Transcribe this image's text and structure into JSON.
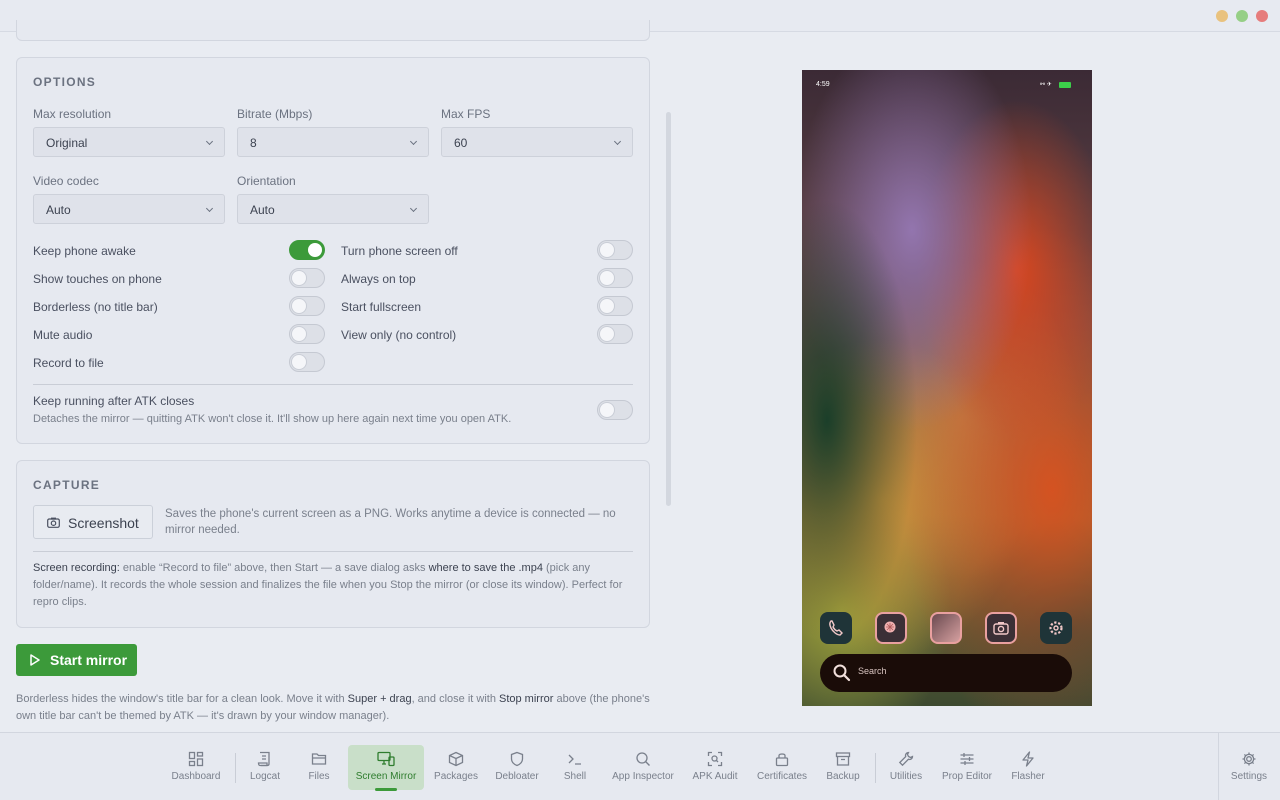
{
  "options": {
    "title": "OPTIONS",
    "max_resolution": {
      "label": "Max resolution",
      "value": "Original"
    },
    "bitrate": {
      "label": "Bitrate (Mbps)",
      "value": "8"
    },
    "max_fps": {
      "label": "Max FPS",
      "value": "60"
    },
    "video_codec": {
      "label": "Video codec",
      "value": "Auto"
    },
    "orientation": {
      "label": "Orientation",
      "value": "Auto"
    },
    "toggles_left": [
      {
        "label": "Keep phone awake",
        "on": true
      },
      {
        "label": "Show touches on phone",
        "on": false
      },
      {
        "label": "Borderless (no title bar)",
        "on": false
      },
      {
        "label": "Mute audio",
        "on": false
      },
      {
        "label": "Record to file",
        "on": false
      }
    ],
    "toggles_right": [
      {
        "label": "Turn phone screen off",
        "on": false
      },
      {
        "label": "Always on top",
        "on": false
      },
      {
        "label": "Start fullscreen",
        "on": false
      },
      {
        "label": "View only (no control)",
        "on": false
      }
    ],
    "keep_running": {
      "title": "Keep running after ATK closes",
      "desc": "Detaches the mirror — quitting ATK won't close it. It'll show up here again next time you open ATK.",
      "on": false
    }
  },
  "capture": {
    "title": "CAPTURE",
    "screenshot_label": "Screenshot",
    "screenshot_desc": "Saves the phone's current screen as a PNG. Works anytime a device is connected — no mirror needed.",
    "rec_lead": "Screen recording:",
    "rec_mid1": " enable “Record to file” above, then Start — a save dialog asks ",
    "rec_emph": "where to save the .mp4",
    "rec_tail": " (pick any folder/name). It records the whole session and finalizes the file when you Stop the mirror (or close its window). Perfect for repro clips."
  },
  "start_label": "Start mirror",
  "footnote": {
    "p1": "Borderless hides the window's title bar for a clean look. Move it with ",
    "k1": "Super + drag",
    "p2": ", and close it with ",
    "k2": "Stop mirror",
    "p3": " above (the phone's own title bar can't be themed by ATK — it's drawn by your window manager)."
  },
  "phone": {
    "time": "4:59",
    "status_icons": "⚯ ✈",
    "search_label": "Search",
    "battery_color": "#3ccf4a",
    "dock": [
      "phone-icon",
      "app-icon",
      "gallery-icon",
      "camera-icon",
      "settings-icon"
    ]
  },
  "nav": {
    "items": [
      {
        "label": "Dashboard",
        "icon": "dashboard-icon"
      },
      {
        "label": "Logcat",
        "icon": "logcat-icon"
      },
      {
        "label": "Files",
        "icon": "folder-icon"
      },
      {
        "label": "Screen Mirror",
        "icon": "screen-mirror-icon",
        "active": true
      },
      {
        "label": "Packages",
        "icon": "package-icon"
      },
      {
        "label": "Debloater",
        "icon": "shield-icon"
      },
      {
        "label": "Shell",
        "icon": "terminal-icon"
      },
      {
        "label": "App Inspector",
        "icon": "search-icon"
      },
      {
        "label": "APK Audit",
        "icon": "scan-icon"
      },
      {
        "label": "Certificates",
        "icon": "lock-icon"
      },
      {
        "label": "Backup",
        "icon": "archive-icon"
      },
      {
        "label": "Utilities",
        "icon": "wrench-icon"
      },
      {
        "label": "Prop Editor",
        "icon": "sliders-icon"
      },
      {
        "label": "Flasher",
        "icon": "bolt-icon"
      }
    ],
    "settings_label": "Settings"
  },
  "colors": {
    "accent": "#3c9a3a",
    "window_min": "#e9c27e",
    "window_max": "#96cf86",
    "window_close": "#e67c7c"
  }
}
